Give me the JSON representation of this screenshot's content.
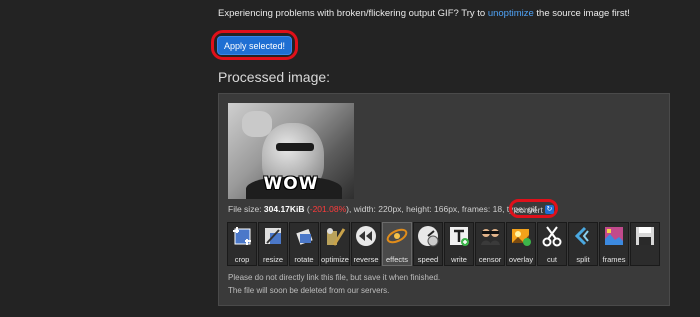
{
  "notice": {
    "before": "Experiencing problems with broken/flickering output GIF? Try to ",
    "link": "unoptimize",
    "after": " the source image first!"
  },
  "apply_button": "Apply selected!",
  "section_title": "Processed image:",
  "preview": {
    "caption": "WOW"
  },
  "file_info": {
    "label_size": "File size: ",
    "size": "304.17KiB",
    "open": " (",
    "change": "-201.08%",
    "rest": "), width: 220px, height: 166px, frames: 18, type: gif"
  },
  "convert_label": "convert",
  "tools": [
    {
      "label": "crop",
      "icon": "crop-icon"
    },
    {
      "label": "resize",
      "icon": "resize-icon"
    },
    {
      "label": "rotate",
      "icon": "rotate-icon"
    },
    {
      "label": "optimize",
      "icon": "optimize-icon"
    },
    {
      "label": "reverse",
      "icon": "reverse-icon"
    },
    {
      "label": "effects",
      "icon": "effects-icon"
    },
    {
      "label": "speed",
      "icon": "speed-icon"
    },
    {
      "label": "write",
      "icon": "write-icon"
    },
    {
      "label": "censor",
      "icon": "censor-icon"
    },
    {
      "label": "overlay",
      "icon": "overlay-icon"
    },
    {
      "label": "cut",
      "icon": "scissors-icon"
    },
    {
      "label": "split",
      "icon": "split-icon"
    },
    {
      "label": "frames",
      "icon": "frames-icon"
    },
    {
      "label": "",
      "icon": "save-icon"
    }
  ],
  "notes": [
    "Please do not directly link this file, but save it when finished.",
    "The file will soon be deleted from our servers."
  ],
  "colors": {
    "accent": "#1f6fd3",
    "highlight": "#e0101a",
    "link": "#4fa3f7"
  }
}
